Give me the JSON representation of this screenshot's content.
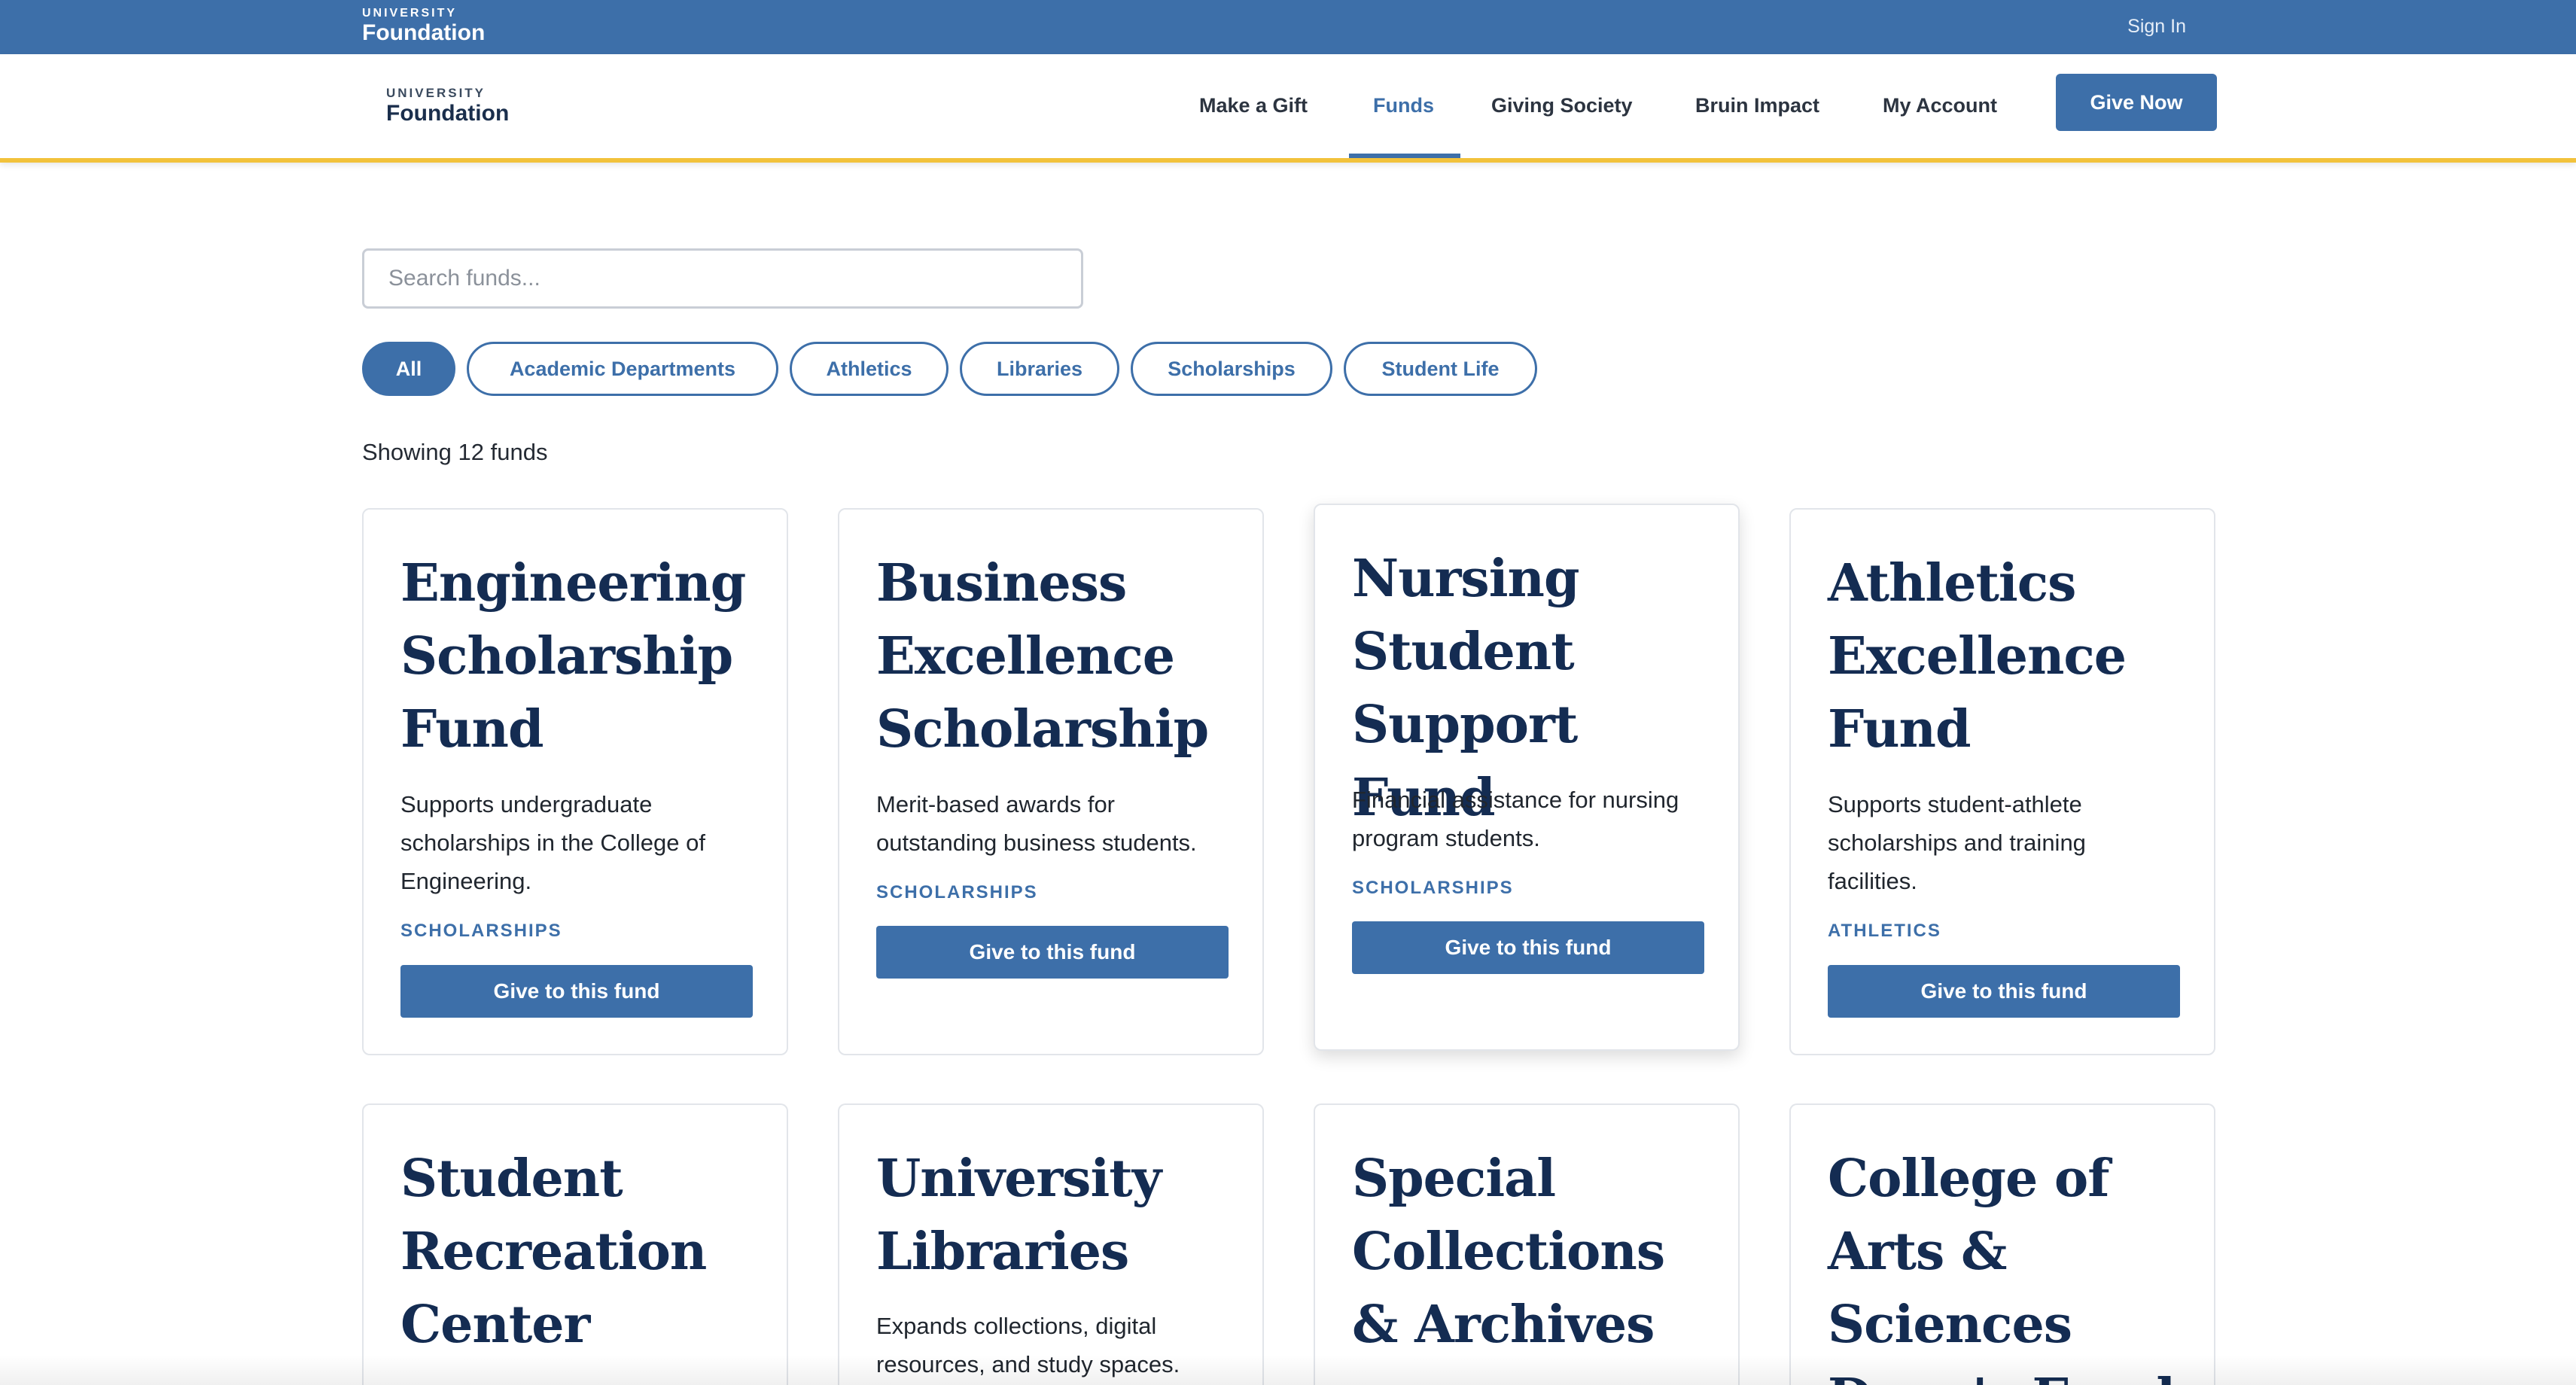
{
  "utility": {
    "logo_small": "UNIVERSITY",
    "logo_big": "Foundation",
    "sign_in": "Sign In"
  },
  "nav": {
    "logo_small": "UNIVERSITY",
    "logo_big": "Foundation",
    "links": [
      "Make a Gift",
      "Funds",
      "Giving Society",
      "Bruin Impact",
      "My Account"
    ],
    "active_link": "Funds",
    "cta": "Give Now"
  },
  "search": {
    "placeholder": "Search funds...",
    "value": ""
  },
  "filters": {
    "chips": [
      "All",
      "Academic Departments",
      "Athletics",
      "Libraries",
      "Scholarships",
      "Student Life"
    ],
    "active": "All"
  },
  "results": {
    "count_text": "Showing 12 funds"
  },
  "funds": [
    {
      "title": "Engineering Scholarship Fund",
      "description": "Supports undergraduate scholarships in the College of Engineering.",
      "category": "Scholarships",
      "button": "Give to this fund"
    },
    {
      "title": "Business Excellence Scholarship",
      "description": "Merit-based awards for outstanding business students.",
      "category": "Scholarships",
      "button": "Give to this fund"
    },
    {
      "title": "Nursing Student Support Fund",
      "description": "Financial assistance for nursing program students.",
      "category": "Scholarships",
      "button": "Give to this fund"
    },
    {
      "title": "Athletics Excellence Fund",
      "description": "Supports student-athlete scholarships and training facilities.",
      "category": "Athletics",
      "button": "Give to this fund"
    },
    {
      "title": "Student Recreation Center",
      "description": "",
      "category": "",
      "button": ""
    },
    {
      "title": "University Libraries",
      "description": "Expands collections, digital resources, and study spaces.",
      "category": "",
      "button": ""
    },
    {
      "title": "Special Collections & Archives",
      "description": "",
      "category": "",
      "button": ""
    },
    {
      "title": "College of Arts & Sciences Dean's Fund",
      "description": "",
      "category": "",
      "button": ""
    }
  ],
  "colors": {
    "brand_blue": "#3d6fa9",
    "accent_gold": "#f2c23b",
    "title_navy": "#142c52"
  }
}
